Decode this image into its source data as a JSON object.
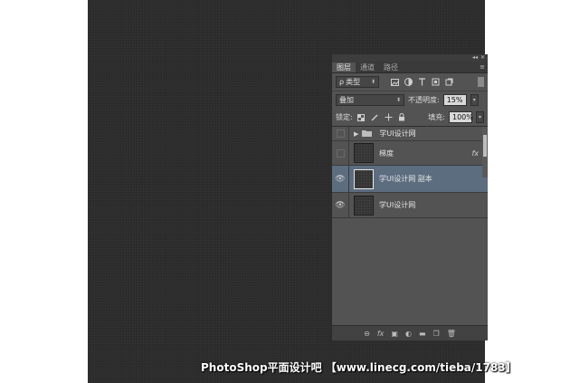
{
  "panel": {
    "top_controls": [
      "◂◂",
      "✕"
    ],
    "tabs": [
      {
        "label": "图层",
        "active": true
      },
      {
        "label": "通道",
        "active": false
      },
      {
        "label": "路径",
        "active": false
      }
    ],
    "filter": {
      "search_symbol": "ρ",
      "kind_label": "类型"
    },
    "blend": {
      "mode": "叠加",
      "opacity_label": "不透明度:",
      "opacity_value": "15%"
    },
    "lock": {
      "label": "锁定:",
      "fill_label": "填充:",
      "fill_value": "100%"
    },
    "layers": [
      {
        "name": "学UI设计网",
        "type": "group",
        "visible": false
      },
      {
        "name": "梯度",
        "type": "layer",
        "visible": false,
        "fx": "fx"
      },
      {
        "name": "学UI设计网 副本",
        "type": "layer",
        "visible": true,
        "selected": true
      },
      {
        "name": "学UI设计网",
        "type": "layer",
        "visible": true
      }
    ]
  },
  "watermark": "PhotoShop平面设计吧 【www.linecg.com/tieba/1783】"
}
